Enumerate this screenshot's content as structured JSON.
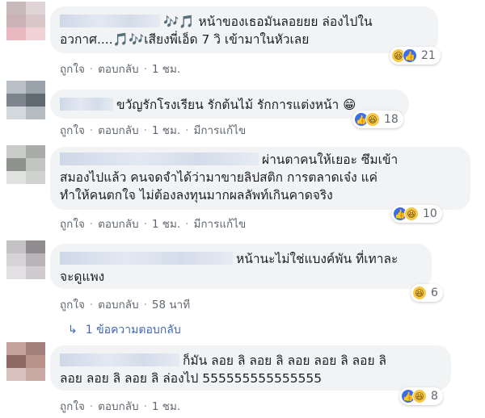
{
  "comments": [
    {
      "lines": [
        "🎶🎵 หน้าของเธอมันลอยยย ล่องไปใน",
        "อวกาศ....🎵🎶เสียงพี่เอ็ด 7 วิ เข้ามาในหัวเลย"
      ],
      "like": "ถูกใจ",
      "reply": "ตอบกลับ",
      "time": "1 ชม.",
      "edited": "",
      "reaction_count": "21",
      "avatar_colors": [
        "#c8b9bb",
        "#e1d4d6",
        "#cbb2b6",
        "#d9c7ca",
        "#e7b9bf",
        "#f0d2d6"
      ]
    },
    {
      "lines": [
        "ขวัญรักโรงเรียน รักต้นไม้ รักการแต่งหน้า 😁"
      ],
      "like": "ถูกใจ",
      "reply": "ตอบกลับ",
      "time": "1 ชม.",
      "edited": "มีการแก้ไข",
      "reaction_count": "18",
      "avatar_colors": [
        "#b9c0c7",
        "#9aa3ac",
        "#7c858e",
        "#5f6971",
        "#d3d8dc",
        "#b5bcc2"
      ]
    },
    {
      "lines": [
        "ผ่านตาคนให้เยอะ ซึมเข้า",
        "สมองไปแล้ว คนจดจำได้ว่ามาขายลิปสติก การตลาดเจ๋ง แค่",
        "ทำให้คนตกใจ ไม่ต้องลงทุนมากผลลัพท์เกินคาดจริง"
      ],
      "like": "ถูกใจ",
      "reply": "ตอบกลับ",
      "time": "1 ชม.",
      "edited": "มีการแก้ไข",
      "reaction_count": "10",
      "avatar_colors": [
        "#c9cbc9",
        "#a9aca9",
        "#8d928d",
        "#c2c5c2",
        "#e0e2e0",
        "#d0d3d0"
      ]
    },
    {
      "lines": [
        "หน้านะไม่ใช่แบงค์พัน ที่เทาละ",
        "จะดูแพง"
      ],
      "like": "ถูกใจ",
      "reply": "ตอบกลับ",
      "time": "58 นาที",
      "edited": "",
      "reaction_count": "6",
      "avatar_colors": [
        "#c4c2c4",
        "#8f8b8f",
        "#d6d3d6",
        "#b8b4b8",
        "#e2e0e2",
        "#cfcbcf"
      ]
    },
    {
      "lines": [
        "ก็มัน ลอย ลิ ลอย ลิ ลอย ลอย ลิ ลอย ลิ",
        "ลอย ลอย ลิ ลอย ลิ ล่องไป 555555555555555"
      ],
      "like": "ถูกใจ",
      "reply": "ตอบกลับ",
      "time": "1 ชม.",
      "edited": "",
      "reaction_count": "8",
      "avatar_colors": [
        "#c4a39c",
        "#a27f7a",
        "#8e6964",
        "#b9928b",
        "#d8c1bc",
        "#c9aaa4"
      ]
    }
  ],
  "reply_thread": {
    "label": "1 ข้อความตอบกลับ"
  },
  "colors": {
    "bubble": "#f2f3f5",
    "link_gray": "#606770",
    "reply_blue": "#4267b2",
    "like_blue": "#3b6ee8",
    "haha_yellow": "#f7c844"
  }
}
